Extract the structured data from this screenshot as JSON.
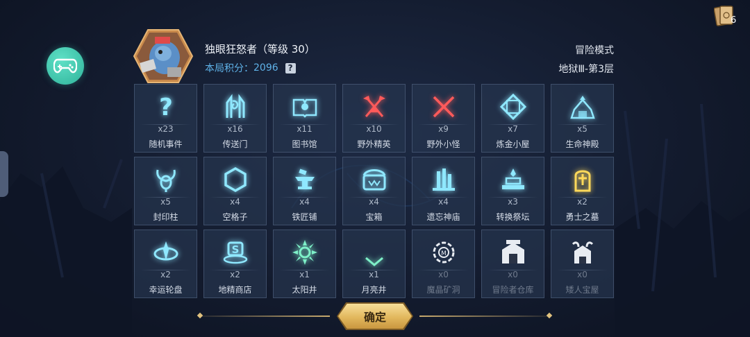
{
  "player": {
    "name": "独眼狂怒者（等级 30）",
    "score_label": "本局积分：",
    "score_value": "2096",
    "help_icon": "?"
  },
  "mode": {
    "name": "冒险模式",
    "floor": "地狱Ⅲ-第3层"
  },
  "top_right": {
    "card_count": "6",
    "icon": "cards-icon"
  },
  "left_button": {
    "icon": "gamepad-icon"
  },
  "tiles": [
    {
      "name": "随机事件",
      "count": "x23",
      "icon": "question-icon",
      "color": "#8fe8ff",
      "disabled": false
    },
    {
      "name": "传送门",
      "count": "x16",
      "icon": "portal-icon",
      "color": "#8fe8ff",
      "disabled": false
    },
    {
      "name": "图书馆",
      "count": "x11",
      "icon": "book-icon",
      "color": "#8fe8ff",
      "disabled": false
    },
    {
      "name": "野外精英",
      "count": "x10",
      "icon": "crossed-axes-icon",
      "color": "#ff5a5a",
      "disabled": false
    },
    {
      "name": "野外小怪",
      "count": "x9",
      "icon": "crossed-swords-icon",
      "color": "#ff5a5a",
      "disabled": false
    },
    {
      "name": "炼金小屋",
      "count": "x7",
      "icon": "alchemy-icon",
      "color": "#8fe8ff",
      "disabled": false
    },
    {
      "name": "生命神殿",
      "count": "x5",
      "icon": "temple-icon",
      "color": "#8fe8ff",
      "disabled": false
    },
    {
      "name": "封印柱",
      "count": "x5",
      "icon": "seal-pillar-icon",
      "color": "#8fe8ff",
      "disabled": false
    },
    {
      "name": "空格子",
      "count": "x4",
      "icon": "hexagon-icon",
      "color": "#8fe8ff",
      "disabled": false
    },
    {
      "name": "铁匠铺",
      "count": "x4",
      "icon": "anvil-icon",
      "color": "#8fe8ff",
      "disabled": false
    },
    {
      "name": "宝箱",
      "count": "x4",
      "icon": "chest-icon",
      "color": "#8fe8ff",
      "disabled": false
    },
    {
      "name": "遗忘神庙",
      "count": "x4",
      "icon": "ruins-icon",
      "color": "#8fe8ff",
      "disabled": false
    },
    {
      "name": "转换祭坛",
      "count": "x3",
      "icon": "altar-icon",
      "color": "#8fe8ff",
      "disabled": false
    },
    {
      "name": "勇士之墓",
      "count": "x2",
      "icon": "tomb-icon",
      "color": "#ffd95a",
      "disabled": false
    },
    {
      "name": "幸运轮盘",
      "count": "x2",
      "icon": "wheel-icon",
      "color": "#8fe8ff",
      "disabled": false
    },
    {
      "name": "地精商店",
      "count": "x2",
      "icon": "shop-icon",
      "color": "#8fe8ff",
      "disabled": false
    },
    {
      "name": "太阳井",
      "count": "x1",
      "icon": "sun-icon",
      "color": "#7ef0c8",
      "disabled": false
    },
    {
      "name": "月亮井",
      "count": "x1",
      "icon": "moon-icon",
      "color": "#7ef0c8",
      "disabled": false
    },
    {
      "name": "魔晶矿洞",
      "count": "x0",
      "icon": "mine-icon",
      "color": "#e8ecf2",
      "disabled": true
    },
    {
      "name": "冒险者仓库",
      "count": "x0",
      "icon": "warehouse-icon",
      "color": "#e8ecf2",
      "disabled": true
    },
    {
      "name": "矮人宝屋",
      "count": "x0",
      "icon": "dwarf-house-icon",
      "color": "#e8ecf2",
      "disabled": true
    }
  ],
  "confirm": {
    "label": "确定"
  }
}
